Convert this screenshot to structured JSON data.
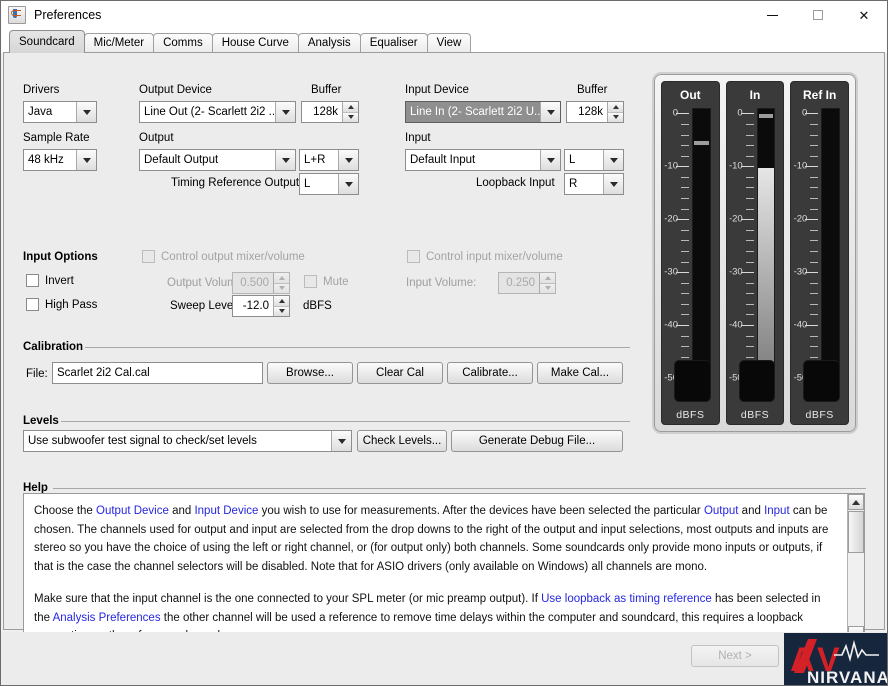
{
  "window": {
    "title": "Preferences",
    "icon": "java-coffee-icon",
    "controls": {
      "minimize": "minimize-icon",
      "maximize": "maximize-icon",
      "close": "close-icon"
    }
  },
  "tabs": [
    {
      "label": "Soundcard",
      "selected": true
    },
    {
      "label": "Mic/Meter",
      "selected": false
    },
    {
      "label": "Comms",
      "selected": false
    },
    {
      "label": "House Curve",
      "selected": false
    },
    {
      "label": "Analysis",
      "selected": false
    },
    {
      "label": "Equaliser",
      "selected": false
    },
    {
      "label": "View",
      "selected": false
    }
  ],
  "soundcard": {
    "drivers_label": "Drivers",
    "drivers_value": "Java",
    "sample_rate_label": "Sample Rate",
    "sample_rate_value": "48 kHz",
    "output_device_label": "Output Device",
    "output_device_value": "Line Out (2- Scarlett 2i2 ...",
    "output_buffer_label": "Buffer",
    "output_buffer_value": "128k",
    "output_label": "Output",
    "output_value": "Default Output",
    "output_channel_value": "L+R",
    "timing_ref_label": "Timing Reference Output",
    "timing_ref_value": "L",
    "input_device_label": "Input Device",
    "input_device_value": "Line In (2- Scarlett 2i2 U...",
    "input_buffer_label": "Buffer",
    "input_buffer_value": "128k",
    "input_label": "Input",
    "input_value": "Default Input",
    "input_channel_value": "L",
    "loopback_label": "Loopback Input",
    "loopback_value": "R"
  },
  "input_options": {
    "title": "Input Options",
    "invert_label": "Invert",
    "invert_checked": false,
    "high_pass_label": "High Pass",
    "high_pass_checked": false,
    "control_output_mixer_label": "Control output mixer/volume",
    "control_output_mixer_checked": false,
    "output_volume_label": "Output Volume:",
    "output_volume_value": "0.500",
    "mute_label": "Mute",
    "mute_checked": false,
    "sweep_level_label": "Sweep Level:",
    "sweep_level_value": "-12.0",
    "sweep_level_unit": "dBFS",
    "control_input_mixer_label": "Control input mixer/volume",
    "control_input_mixer_checked": false,
    "input_volume_label": "Input Volume:",
    "input_volume_value": "0.250"
  },
  "calibration": {
    "title": "Calibration",
    "file_label": "File:",
    "file_value": "Scarlet 2i2 Cal.cal",
    "browse_label": "Browse...",
    "clear_label": "Clear Cal",
    "calibrate_label": "Calibrate...",
    "make_label": "Make Cal..."
  },
  "levels": {
    "title": "Levels",
    "select_value": "Use subwoofer test signal to check/set levels",
    "check_levels_label": "Check Levels...",
    "generate_debug_label": "Generate Debug File..."
  },
  "meters": {
    "unit": "dBFS",
    "scale_labels": [
      "0",
      "-10",
      "-20",
      "-30",
      "-40",
      "-50"
    ],
    "channels": [
      {
        "name": "Out",
        "level_db": -50.0,
        "peak_db": -2.0,
        "readout": ""
      },
      {
        "name": "In",
        "level_db": -10.2,
        "peak_db": -0.3,
        "readout": ""
      },
      {
        "name": "Ref In",
        "level_db": -50.0,
        "peak_db": null,
        "readout": ""
      }
    ]
  },
  "help": {
    "title": "Help",
    "paragraph1": [
      {
        "t": "Choose the "
      },
      {
        "t": "Output Device",
        "link": true
      },
      {
        "t": " and "
      },
      {
        "t": "Input Device",
        "link": true
      },
      {
        "t": " you wish to use for measurements. After the devices have been selected the particular "
      },
      {
        "t": "Output",
        "link": true
      },
      {
        "t": " and "
      },
      {
        "t": "Input",
        "link": true
      },
      {
        "t": " can be chosen. The channels used for output and input are selected from the drop downs to the right of the output and input selections, most outputs and inputs are stereo so you have the choice of using the left or right channel, or (for output only) both channels. Some soundcards only provide mono inputs or outputs, if that is the case the channel selectors will be disabled. Note that for ASIO drivers (only available on Windows) all channels are mono."
      }
    ],
    "paragraph2": [
      {
        "t": "Make sure that the input channel is the one connected to your SPL meter (or mic preamp output). If "
      },
      {
        "t": "Use loopback as timing reference",
        "link": true
      },
      {
        "t": " has been selected in the "
      },
      {
        "t": "Analysis Preferences",
        "link": true
      },
      {
        "t": " the other channel will be used a reference to remove time delays within the computer and soundcard, this requires a loopback connection on the reference channel."
      }
    ]
  },
  "footer": {
    "next_label": "Next >",
    "next_enabled": false,
    "logo_primary": "AV",
    "logo_secondary": "NIRVANA",
    "logo_accent_color": "#d42027",
    "logo_bg_color": "#16263c"
  }
}
